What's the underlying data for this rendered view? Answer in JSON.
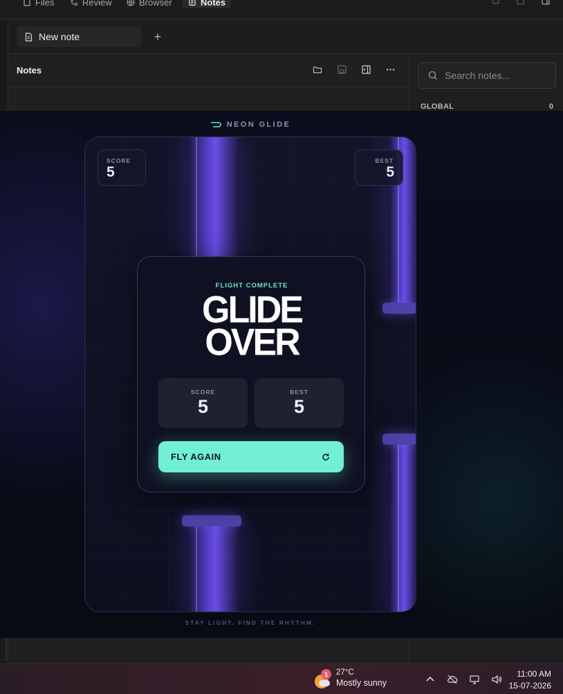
{
  "app": {
    "top_tabs": [
      {
        "label": "Files",
        "icon": "file-icon"
      },
      {
        "label": "Review",
        "icon": "branch-icon"
      },
      {
        "label": "Browser",
        "icon": "globe-icon"
      },
      {
        "label": "Notes",
        "icon": "notes-icon"
      }
    ],
    "note_tab": {
      "label": "New note",
      "add": "+"
    }
  },
  "notes": {
    "title": "Notes",
    "tools": [
      "folder-open-icon",
      "save-icon",
      "split-view-icon",
      "more-icon"
    ]
  },
  "sidebar": {
    "search_placeholder": "Search notes...",
    "global_label": "GLOBAL",
    "global_count": "0"
  },
  "game": {
    "brand": "NEON GLIDE",
    "tagline": "STAY LIGHT. FIND THE RHYTHM.",
    "hud": {
      "score_label": "SCORE",
      "score": "5",
      "best_label": "BEST",
      "best": "5"
    },
    "panel": {
      "kicker": "FLIGHT COMPLETE",
      "line1": "GLIDE",
      "line2": "OVER",
      "score_label": "SCORE",
      "score": "5",
      "best_label": "BEST",
      "best": "5",
      "button": "FLY AGAIN"
    },
    "colors": {
      "accent": "#72f0d4",
      "pillar": "#6a4fe6",
      "background": "#0b0d1c"
    }
  },
  "taskbar": {
    "weather_badge": "1",
    "temperature": "27°C",
    "condition": "Mostly sunny",
    "time": "11:00 AM",
    "date": "15-07-2026"
  }
}
